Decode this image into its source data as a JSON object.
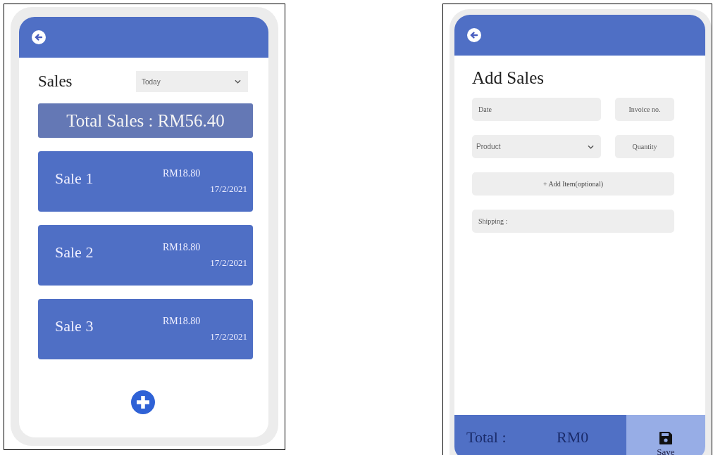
{
  "sales_list_screen": {
    "title": "Sales",
    "period_filter": {
      "value": "Today"
    },
    "total_sales": "Total Sales : RM56.40",
    "sales": [
      {
        "name": "Sale 1",
        "amount": "RM18.80",
        "date": "17/2/2021"
      },
      {
        "name": "Sale 2",
        "amount": "RM18.80",
        "date": "17/2/2021"
      },
      {
        "name": "Sale 3",
        "amount": "RM18.80",
        "date": "17/2/2021"
      }
    ]
  },
  "add_sales_screen": {
    "title": "Add Sales",
    "form_rows": [
      [
        {
          "kind": "input",
          "placeholder": "Date"
        },
        {
          "kind": "input",
          "placeholder": "Invoice no."
        }
      ],
      [
        {
          "kind": "select",
          "placeholder": "Product"
        },
        {
          "kind": "input",
          "placeholder": "Quantity"
        }
      ],
      [
        {
          "kind": "button",
          "label": "+ Add Item(optional)"
        }
      ],
      [
        {
          "kind": "input",
          "placeholder": "Shipping :"
        }
      ]
    ],
    "footer": {
      "total_label": "Total :",
      "total_value": "RM0",
      "save_label": "Save"
    }
  }
}
